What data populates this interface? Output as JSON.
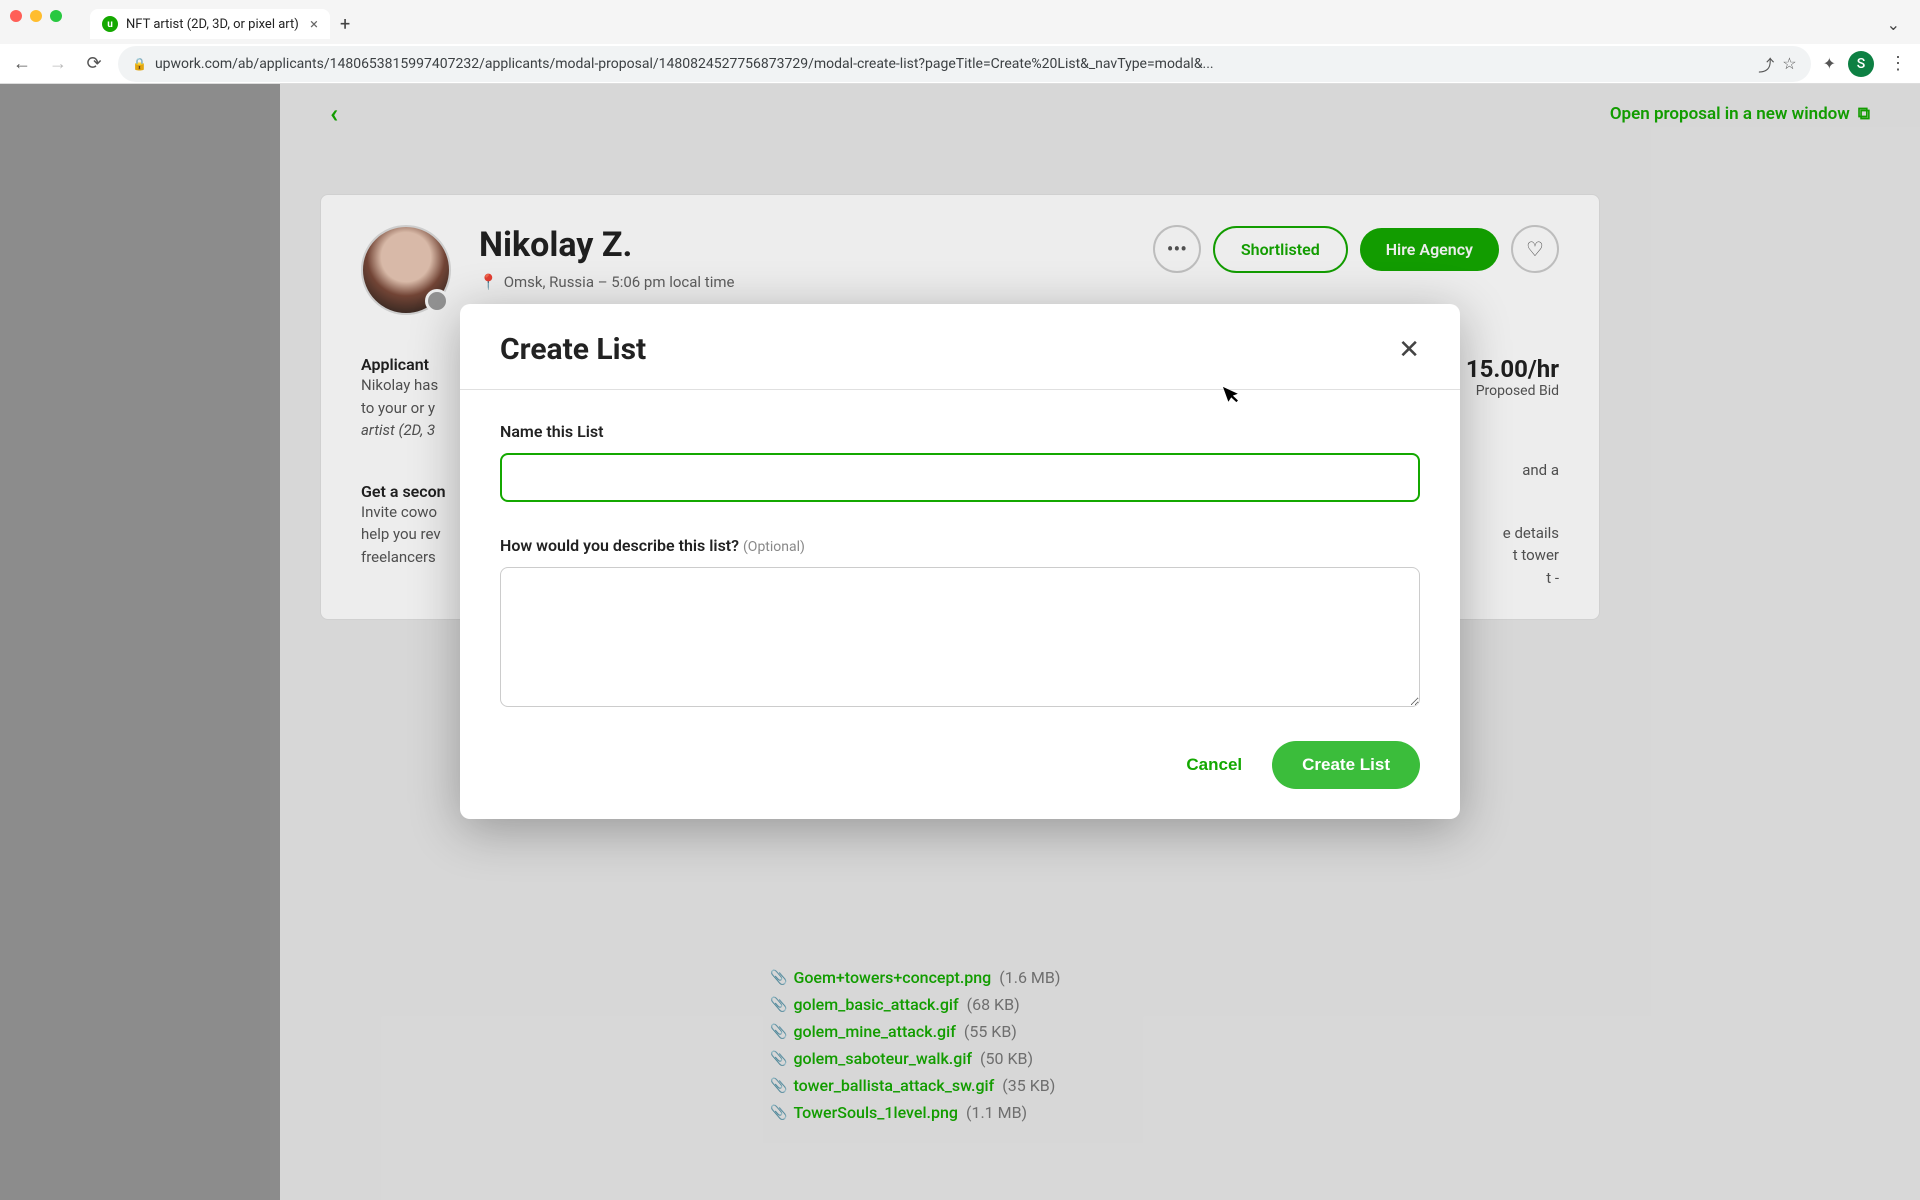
{
  "browser": {
    "tab_title": "NFT artist (2D, 3D, or pixel art)",
    "url": "upwork.com/ab/applicants/1480653815997407232/applicants/modal-proposal/1480824527756873729/modal-create-list?pageTitle=Create%20List&_navType=modal&...",
    "profile_initial": "S"
  },
  "header": {
    "open_new": "Open proposal in a new window"
  },
  "freelancer": {
    "name": "Nikolay Z.",
    "location": "Omsk, Russia – 5:06 pm local time",
    "more": "•••",
    "shortlisted": "Shortlisted",
    "hire": "Hire Agency"
  },
  "sidebar": {
    "applicant_label": "Applicant",
    "applicant_text_1": "Nikolay has",
    "applicant_text_2": "to your or y",
    "applicant_text_3": "artist (2D, 3",
    "second_label": "Get a secon",
    "second_text_1": "Invite cowo",
    "second_text_2": "help you rev",
    "second_text_3": "freelancers"
  },
  "bid": {
    "rate": "15.00/hr",
    "label": "Proposed Bid",
    "peek1": "and a",
    "peek2": "e details",
    "peek3": "t tower",
    "peek4": "t -"
  },
  "attachments": [
    {
      "name": "Goem+towers+concept.png",
      "size": "(1.6 MB)"
    },
    {
      "name": "golem_basic_attack.gif",
      "size": "(68 KB)"
    },
    {
      "name": "golem_mine_attack.gif",
      "size": "(55 KB)"
    },
    {
      "name": "golem_saboteur_walk.gif",
      "size": "(50 KB)"
    },
    {
      "name": "tower_ballista_attack_sw.gif",
      "size": "(35 KB)"
    },
    {
      "name": "TowerSouls_1level.png",
      "size": "(1.1 MB)"
    }
  ],
  "modal": {
    "title": "Create List",
    "name_label": "Name this List",
    "desc_label": "How would you describe this list? ",
    "optional": "(Optional)",
    "cancel": "Cancel",
    "submit": "Create List"
  }
}
